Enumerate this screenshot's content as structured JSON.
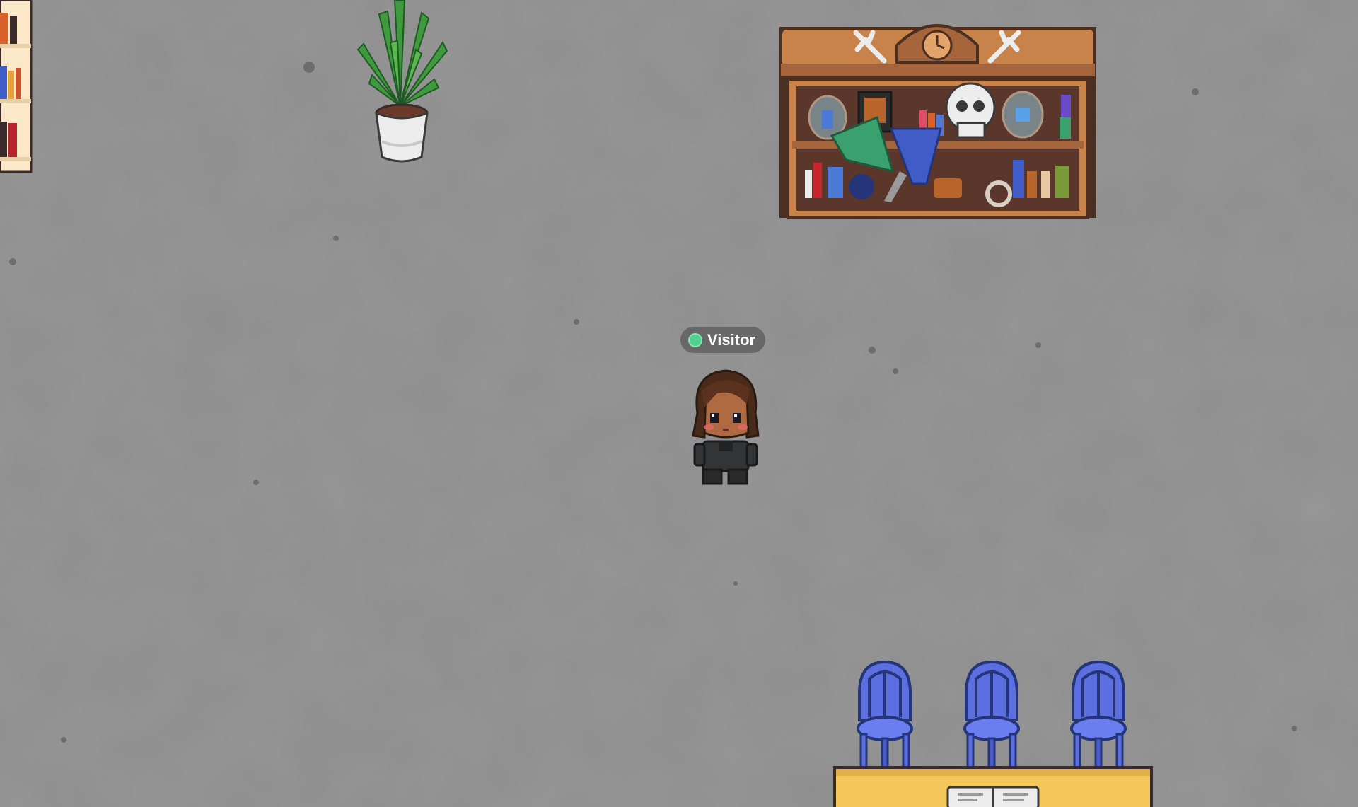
{
  "player": {
    "name": "Visitor",
    "status": "online",
    "status_color": "#4fd18b"
  },
  "map": {
    "floor": "concrete",
    "objects": [
      "bookshelf",
      "potted-plant",
      "curiosity-cabinet",
      "chair",
      "chair",
      "chair",
      "table"
    ]
  },
  "colors": {
    "floor": "#8b8b8b",
    "chair": "#5b6fe0",
    "table": "#f4c75a",
    "cabinet": "#b5733f"
  }
}
